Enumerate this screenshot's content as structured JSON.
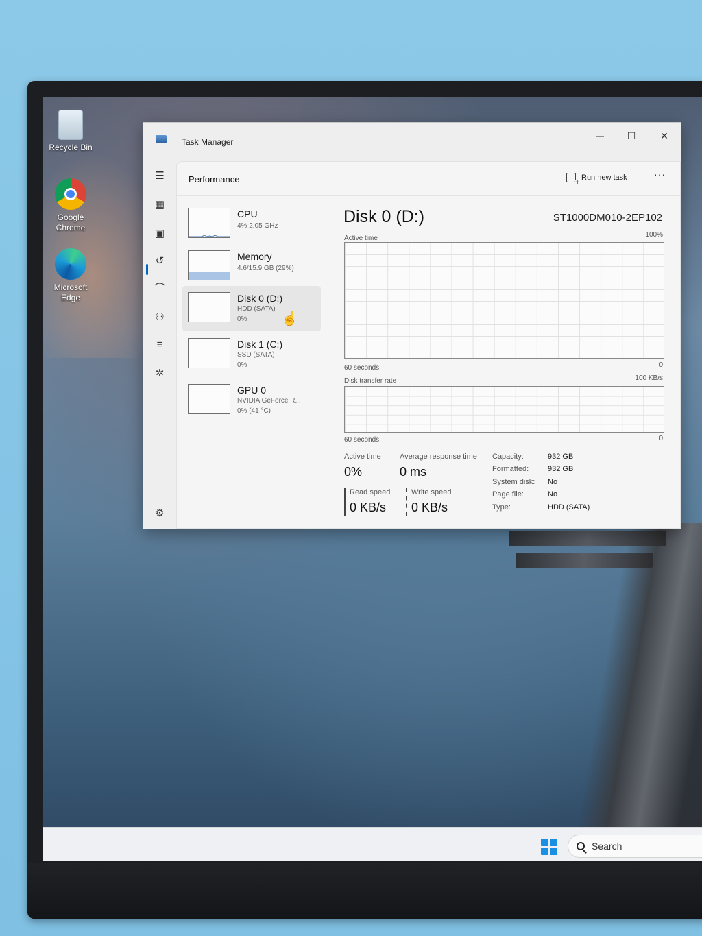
{
  "desktop": {
    "icons": [
      {
        "label": "Recycle Bin"
      },
      {
        "label": "Google Chrome"
      },
      {
        "label": "Microsoft Edge"
      }
    ]
  },
  "window": {
    "title": "Task Manager",
    "controls": {
      "minimize": "—",
      "maximize": "☐",
      "close": "✕"
    }
  },
  "header": {
    "page_title": "Performance",
    "run_new_task": "Run new task",
    "more": "···"
  },
  "perf_list": [
    {
      "name": "CPU",
      "line1": "4% 2.05 GHz"
    },
    {
      "name": "Memory",
      "line1": "4.6/15.9 GB (29%)",
      "fill_fraction": 0.29
    },
    {
      "name": "Disk 0 (D:)",
      "line1": "HDD (SATA)",
      "line2": "0%"
    },
    {
      "name": "Disk 1 (C:)",
      "line1": "SSD (SATA)",
      "line2": "0%"
    },
    {
      "name": "GPU 0",
      "line1": "NVIDIA GeForce R...",
      "line2": "0% (41 °C)"
    }
  ],
  "detail": {
    "title": "Disk 0 (D:)",
    "model": "ST1000DM010-2EP102",
    "graph1": {
      "label": "Active time",
      "max": "100%",
      "time": "60 seconds",
      "min": "0"
    },
    "graph2": {
      "label": "Disk transfer rate",
      "max": "100 KB/s",
      "time": "60 seconds",
      "min": "0"
    },
    "stats": {
      "active_time_label": "Active time",
      "active_time_value": "0%",
      "avg_response_label": "Average response time",
      "avg_response_value": "0 ms",
      "read_speed_label": "Read speed",
      "read_speed_value": "0 KB/s",
      "write_speed_label": "Write speed",
      "write_speed_value": "0 KB/s"
    },
    "properties": [
      {
        "key": "Capacity:",
        "value": "932 GB"
      },
      {
        "key": "Formatted:",
        "value": "932 GB"
      },
      {
        "key": "System disk:",
        "value": "No"
      },
      {
        "key": "Page file:",
        "value": "No"
      },
      {
        "key": "Type:",
        "value": "HDD (SATA)"
      }
    ]
  },
  "taskbar": {
    "search_label": "Search"
  }
}
